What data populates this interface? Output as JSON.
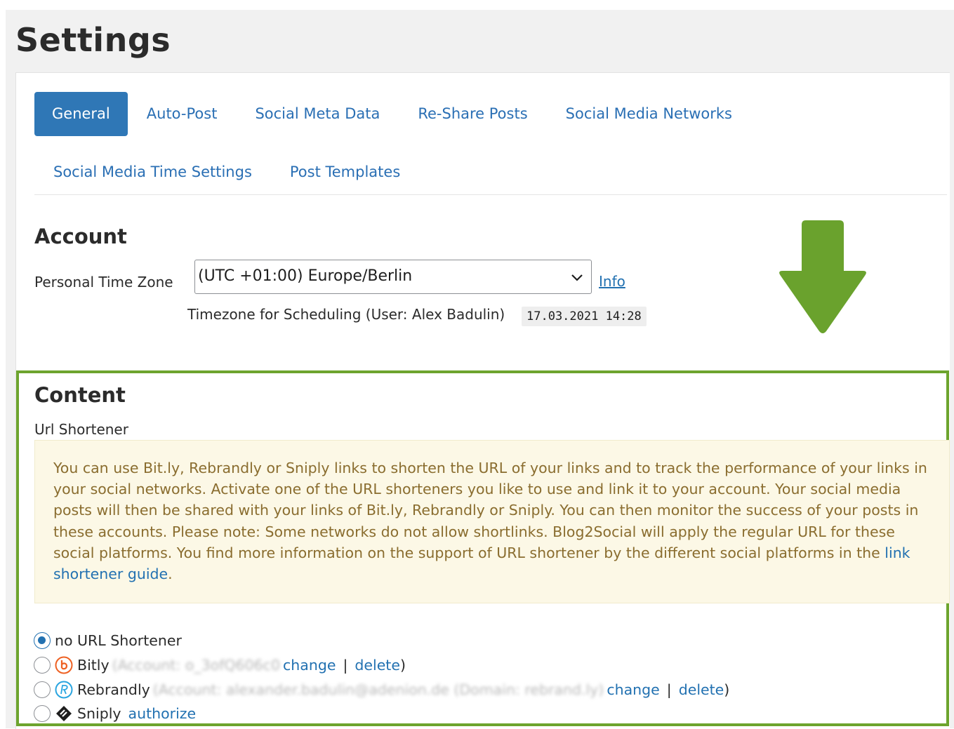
{
  "page": {
    "title": "Settings"
  },
  "tabs": [
    {
      "label": "General",
      "active": true
    },
    {
      "label": "Auto-Post"
    },
    {
      "label": "Social Meta Data"
    },
    {
      "label": "Re-Share Posts"
    },
    {
      "label": "Social Media Networks"
    },
    {
      "label": "Social Media Time Settings"
    },
    {
      "label": "Post Templates"
    }
  ],
  "account": {
    "heading": "Account",
    "timezone_label": "Personal Time Zone",
    "timezone_value": "(UTC +01:00) Europe/Berlin",
    "info_link": "Info",
    "scheduling_note": "Timezone for Scheduling (User: Alex Badulin)",
    "scheduling_time": "17.03.2021 14:28"
  },
  "content": {
    "heading": "Content",
    "url_shortener_label": "Url Shortener",
    "notice_text": "You can use Bit.ly, Rebrandly or Sniply links to shorten the URL of your links and to track the performance of your links in your social networks. Activate one of the URL shorteners you like to use and link it to your account. Your social media posts will then be shared with your links of Bit.ly, Rebrandly or Sniply. You can then monitor the success of your posts in these accounts. Please note: Some networks do not allow shortlinks. Blog2Social will apply the regular URL for these social platforms. You find more information on the support of URL shortener by the different social platforms in the ",
    "notice_link": "link shortener guide",
    "notice_end": ".",
    "options": {
      "none": {
        "label": "no URL Shortener",
        "checked": true
      },
      "bitly": {
        "label": "Bitly",
        "account": "(Account: o_3ofQ606c0",
        "change": "change",
        "sep": "|",
        "delete": "delete",
        "close": ")"
      },
      "rebrandly": {
        "label": "Rebrandly",
        "account": "(Account: alexander.badulin@adenion.de (Domain: rebrand.ly)",
        "change": "change",
        "sep": "|",
        "delete": "delete",
        "close": ")"
      },
      "sniply": {
        "label": "Sniply",
        "authorize": "authorize"
      }
    }
  },
  "colors": {
    "accent": "#2f77b6",
    "link": "#2271b1",
    "highlight_border": "#6da42e",
    "arrow": "#6aa22d",
    "notice_bg": "#fcf8e6",
    "notice_text": "#8a6d2f",
    "bitly_icon": "#ee6123",
    "rebrandly_icon": "#2aa5e0"
  }
}
